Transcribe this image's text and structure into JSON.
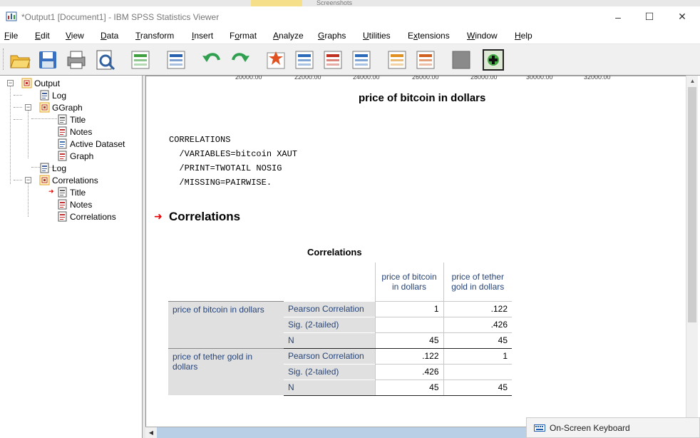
{
  "window": {
    "title": "*Output1 [Document1] - IBM SPSS Statistics Viewer",
    "minimize": "–",
    "maximize": "☐",
    "close": "✕"
  },
  "taskbar_top": {
    "tab_faded": "Screenshots"
  },
  "menu": {
    "items": [
      {
        "label": "File",
        "u": "F"
      },
      {
        "label": "Edit",
        "u": "E"
      },
      {
        "label": "View",
        "u": "V"
      },
      {
        "label": "Data",
        "u": "D"
      },
      {
        "label": "Transform",
        "u": "T"
      },
      {
        "label": "Insert",
        "u": "I"
      },
      {
        "label": "Format",
        "u": "o"
      },
      {
        "label": "Analyze",
        "u": "A"
      },
      {
        "label": "Graphs",
        "u": "G"
      },
      {
        "label": "Utilities",
        "u": "U"
      },
      {
        "label": "Extensions",
        "u": "x"
      },
      {
        "label": "Window",
        "u": "W"
      },
      {
        "label": "Help",
        "u": "H"
      }
    ]
  },
  "toolbar": {
    "icons": [
      "open-icon",
      "save-icon",
      "print-icon",
      "print-preview-icon",
      "export-icon",
      "recall-dialog-icon",
      "undo-icon",
      "redo-icon",
      "goto-data-icon",
      "goto-case-icon",
      "goto-variable-icon",
      "variables-icon",
      "designate-window-icon",
      "create-title-icon",
      "disabled-icon",
      "insert-icon"
    ]
  },
  "outline": {
    "items": [
      {
        "label": "Output",
        "icon": "output-book-icon"
      },
      {
        "label": "Log",
        "icon": "log-icon"
      },
      {
        "label": "GGraph",
        "icon": "procedure-book-icon"
      },
      {
        "label": "Title",
        "icon": "title-icon"
      },
      {
        "label": "Notes",
        "icon": "notes-icon"
      },
      {
        "label": "Active Dataset",
        "icon": "dataset-icon"
      },
      {
        "label": "Graph",
        "icon": "graph-icon"
      },
      {
        "label": "Log",
        "icon": "log-icon"
      },
      {
        "label": "Correlations",
        "icon": "procedure-book-icon"
      },
      {
        "label": "Title",
        "icon": "title-icon"
      },
      {
        "label": "Notes",
        "icon": "notes-icon"
      },
      {
        "label": "Correlations",
        "icon": "table-icon"
      }
    ]
  },
  "content": {
    "axis_ticks": [
      "20000.00",
      "22000.00",
      "24000.00",
      "26000.00",
      "28000.00",
      "30000.00",
      "32000.00"
    ],
    "graph_title": "price of bitcoin in dollars",
    "syntax": [
      "CORRELATIONS",
      "  /VARIABLES=bitcoin XAUT",
      "  /PRINT=TWOTAIL NOSIG",
      "  /MISSING=PAIRWISE."
    ],
    "section_title": "Correlations",
    "table_title": "Correlations",
    "table": {
      "col_headers": [
        "price of bitcoin in dollars",
        "price of tether gold in dollars"
      ],
      "groups": [
        {
          "label": "price of bitcoin in dollars",
          "rows": [
            {
              "stat": "Pearson Correlation",
              "v1": "1",
              "v2": ".122"
            },
            {
              "stat": "Sig. (2-tailed)",
              "v1": "",
              "v2": ".426"
            },
            {
              "stat": "N",
              "v1": "45",
              "v2": "45"
            }
          ]
        },
        {
          "label": "price of tether gold in dollars",
          "rows": [
            {
              "stat": "Pearson Correlation",
              "v1": ".122",
              "v2": "1"
            },
            {
              "stat": "Sig. (2-tailed)",
              "v1": ".426",
              "v2": ""
            },
            {
              "stat": "N",
              "v1": "45",
              "v2": "45"
            }
          ]
        }
      ]
    }
  },
  "osk": {
    "label": "On-Screen Keyboard"
  },
  "colors": {
    "accent_red": "#e00000",
    "table_label": "#264478",
    "table_shade": "#e0e0e0"
  }
}
